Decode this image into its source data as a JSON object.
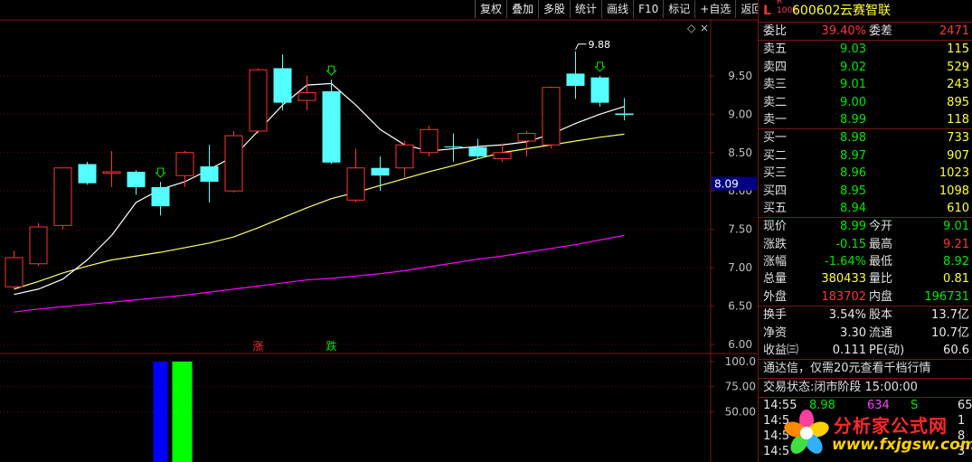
{
  "toolbar": [
    "复权",
    "叠加",
    "多股",
    "统计",
    "画线",
    "F10",
    "标记",
    "+自选",
    "返回"
  ],
  "quote": {
    "prefix": "L",
    "sup_r": "R",
    "sup_num": "1000",
    "code": "600602",
    "name": "云赛智联",
    "webi_label": "委比",
    "webi": "39.40%",
    "weicha_label": "委差",
    "weicha": "2471",
    "sell": [
      {
        "label": "卖五",
        "price": "9.03",
        "vol": "115"
      },
      {
        "label": "卖四",
        "price": "9.02",
        "vol": "529"
      },
      {
        "label": "卖三",
        "price": "9.01",
        "vol": "243"
      },
      {
        "label": "卖二",
        "price": "9.00",
        "vol": "895"
      },
      {
        "label": "卖一",
        "price": "8.99",
        "vol": "118"
      }
    ],
    "buy": [
      {
        "label": "买一",
        "price": "8.98",
        "vol": "733"
      },
      {
        "label": "买二",
        "price": "8.97",
        "vol": "907"
      },
      {
        "label": "买三",
        "price": "8.96",
        "vol": "1023"
      },
      {
        "label": "买四",
        "price": "8.95",
        "vol": "1098"
      },
      {
        "label": "买五",
        "price": "8.94",
        "vol": "610"
      }
    ],
    "stats": [
      {
        "l1": "现价",
        "v1": "8.99",
        "c1": "green",
        "l2": "今开",
        "v2": "9.01",
        "c2": "green"
      },
      {
        "l1": "涨跌",
        "v1": "-0.15",
        "c1": "green",
        "l2": "最高",
        "v2": "9.21",
        "c2": "red"
      },
      {
        "l1": "涨幅",
        "v1": "-1.64%",
        "c1": "green",
        "l2": "最低",
        "v2": "8.92",
        "c2": "green"
      },
      {
        "l1": "总量",
        "v1": "380433",
        "c1": "yellow",
        "l2": "量比",
        "v2": "0.81",
        "c2": "yellow"
      },
      {
        "l1": "外盘",
        "v1": "183702",
        "c1": "red",
        "l2": "内盘",
        "v2": "196731",
        "c2": "green"
      }
    ],
    "fund": [
      {
        "l1": "换手",
        "v1": "3.54%",
        "l2": "股本",
        "v2": "13.7亿"
      },
      {
        "l1": "净资",
        "v1": "3.30",
        "l2": "流通",
        "v2": "10.7亿"
      },
      {
        "l1": "收益㈢",
        "v1": "0.111",
        "l2": "PE(动)",
        "v2": "60.6"
      }
    ],
    "promo": "通达信，仅需20元查看千档行情",
    "state_label": "交易状态:",
    "state_value": "闭市阶段 15:00:00",
    "trades": [
      {
        "time": "14:55",
        "price": "8.98",
        "vol": "634",
        "side": "S",
        "num": "65"
      },
      {
        "time": "14:5",
        "price": "",
        "vol": "",
        "side": "",
        "num": "1"
      },
      {
        "time": "14:5",
        "price": "",
        "vol": "",
        "side": "",
        "num": "8"
      },
      {
        "time": "14:5",
        "price": "",
        "vol": "",
        "side": "",
        "num": "3"
      }
    ]
  },
  "logo": {
    "line1": "分析家公式网",
    "line2": "www.fxjgsw.com"
  },
  "chart_data": {
    "type": "candlestick",
    "price_axis": {
      "ticks": [
        6.0,
        6.5,
        7.0,
        7.5,
        8.0,
        8.5,
        9.0,
        9.5
      ],
      "tick_labels": [
        "6.00",
        "6.50",
        "7.00",
        "7.50",
        "8.00",
        "8.50",
        "9.00",
        "9.50"
      ],
      "ylim": [
        5.88,
        10.23
      ]
    },
    "highlight_label": "8.09",
    "highlight_value": 8.09,
    "max_label": "9.88",
    "candles": [
      {
        "o": 6.75,
        "c": 7.13,
        "h": 7.22,
        "l": 6.72
      },
      {
        "o": 7.05,
        "c": 7.53,
        "h": 7.58,
        "l": 7.02
      },
      {
        "o": 7.55,
        "c": 8.3,
        "h": 8.3,
        "l": 7.5
      },
      {
        "o": 8.35,
        "c": 8.1,
        "h": 8.38,
        "l": 8.08
      },
      {
        "o": 8.23,
        "c": 8.25,
        "h": 8.52,
        "l": 8.05
      },
      {
        "o": 8.25,
        "c": 8.05,
        "h": 8.27,
        "l": 7.95
      },
      {
        "o": 8.05,
        "c": 7.8,
        "h": 8.12,
        "l": 7.68
      },
      {
        "o": 8.2,
        "c": 8.5,
        "h": 8.52,
        "l": 8.05
      },
      {
        "o": 8.32,
        "c": 8.12,
        "h": 8.6,
        "l": 7.85
      },
      {
        "o": 8.0,
        "c": 8.72,
        "h": 8.78,
        "l": 7.98
      },
      {
        "o": 8.78,
        "c": 9.58,
        "h": 9.6,
        "l": 8.75
      },
      {
        "o": 9.6,
        "c": 9.15,
        "h": 9.78,
        "l": 9.05
      },
      {
        "o": 9.18,
        "c": 9.28,
        "h": 9.5,
        "l": 9.05
      },
      {
        "o": 9.3,
        "c": 8.37,
        "h": 9.45,
        "l": 8.35
      },
      {
        "o": 7.88,
        "c": 8.3,
        "h": 8.55,
        "l": 7.85
      },
      {
        "o": 8.3,
        "c": 8.2,
        "h": 8.45,
        "l": 8.0
      },
      {
        "o": 8.3,
        "c": 8.6,
        "h": 8.65,
        "l": 8.18
      },
      {
        "o": 8.5,
        "c": 8.8,
        "h": 8.85,
        "l": 8.45
      },
      {
        "o": 8.58,
        "c": 8.57,
        "h": 8.75,
        "l": 8.38
      },
      {
        "o": 8.57,
        "c": 8.45,
        "h": 8.68,
        "l": 8.42
      },
      {
        "o": 8.42,
        "c": 8.5,
        "h": 8.62,
        "l": 8.38
      },
      {
        "o": 8.65,
        "c": 8.75,
        "h": 8.78,
        "l": 8.45
      },
      {
        "o": 8.6,
        "c": 9.35,
        "h": 9.36,
        "l": 8.55
      },
      {
        "o": 9.53,
        "c": 9.37,
        "h": 9.82,
        "l": 9.2
      },
      {
        "o": 9.48,
        "c": 9.15,
        "h": 9.5,
        "l": 9.1
      },
      {
        "o": 9.01,
        "c": 8.99,
        "h": 9.21,
        "l": 8.92
      }
    ],
    "ma_short": [
      6.65,
      6.72,
      6.85,
      7.1,
      7.42,
      7.85,
      8.02,
      8.12,
      8.28,
      8.45,
      8.78,
      9.12,
      9.38,
      9.4,
      9.12,
      8.8,
      8.6,
      8.52,
      8.55,
      8.58,
      8.6,
      8.64,
      8.74,
      8.88,
      9.0,
      9.1
    ],
    "ma_mid": [
      6.72,
      6.82,
      6.93,
      7.02,
      7.1,
      7.15,
      7.2,
      7.26,
      7.32,
      7.4,
      7.52,
      7.65,
      7.78,
      7.9,
      7.98,
      8.07,
      8.16,
      8.25,
      8.33,
      8.42,
      8.5,
      8.55,
      8.6,
      8.65,
      8.7,
      8.74
    ],
    "ma_long": [
      6.42,
      6.46,
      6.49,
      6.52,
      6.55,
      6.58,
      6.61,
      6.64,
      6.68,
      6.72,
      6.76,
      6.8,
      6.84,
      6.86,
      6.89,
      6.92,
      6.96,
      7.01,
      7.06,
      7.11,
      7.15,
      7.2,
      7.25,
      7.3,
      7.36,
      7.42
    ],
    "markers": [
      {
        "index": 6,
        "type": "down-arrow"
      },
      {
        "index": 13,
        "type": "down-arrow"
      },
      {
        "index": 24,
        "type": "down-arrow"
      }
    ],
    "bottom_labels": [
      {
        "index": 10,
        "text": "涨",
        "color": "#ff3030"
      },
      {
        "index": 13,
        "text": "跌",
        "color": "#00e000"
      }
    ],
    "indicator": {
      "ticks": [
        50,
        75,
        100
      ],
      "tick_labels": [
        "50.00",
        "75.00",
        "100.0"
      ],
      "ylim": [
        0,
        108
      ],
      "bars": [
        {
          "index": 6,
          "value": 100,
          "color": "#0000ff"
        },
        {
          "index": 7,
          "value": 100,
          "color": "#00ff00"
        }
      ]
    }
  }
}
